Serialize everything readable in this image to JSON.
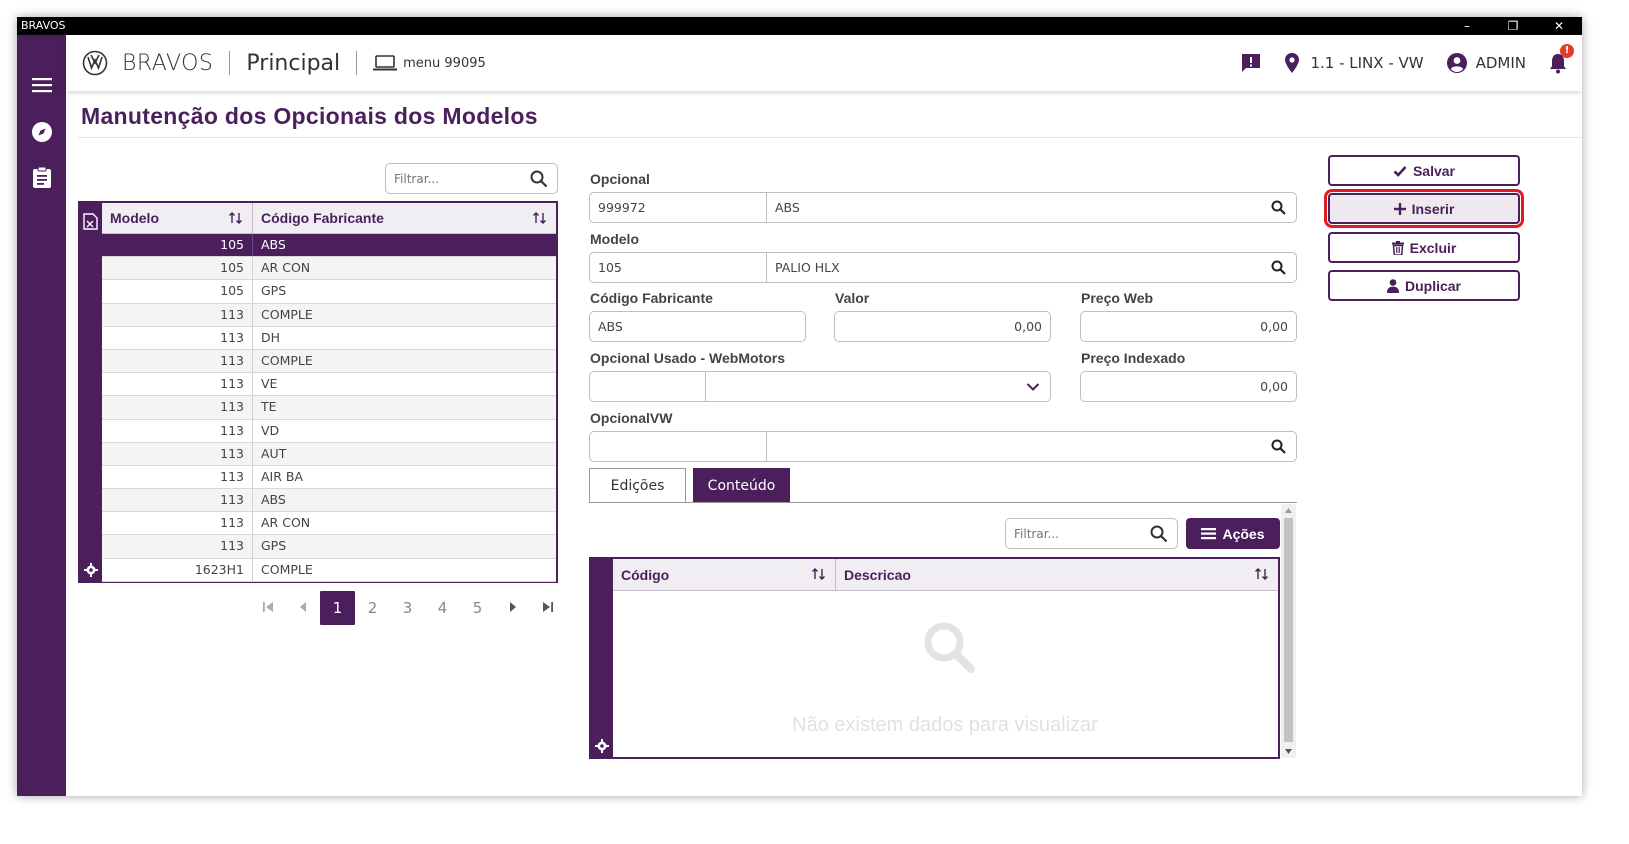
{
  "window": {
    "title": "BRAVOS",
    "minimize": "–",
    "restore": "❐",
    "close": "✕"
  },
  "header": {
    "brand": "BRAVOS",
    "section": "Principal",
    "menu": "menu 99095",
    "location": "1.1 - LINX - VW",
    "user": "ADMIN",
    "notification_badge": "!"
  },
  "page": {
    "title": "Manutenção dos Opcionais dos Modelos"
  },
  "left_grid": {
    "filter_placeholder": "Filtrar...",
    "columns": [
      "Modelo",
      "Código Fabricante"
    ],
    "rows": [
      {
        "modelo": "105",
        "codigo": "ABS",
        "selected": true
      },
      {
        "modelo": "105",
        "codigo": "AR CON"
      },
      {
        "modelo": "105",
        "codigo": "GPS"
      },
      {
        "modelo": "113",
        "codigo": "COMPLE"
      },
      {
        "modelo": "113",
        "codigo": "DH"
      },
      {
        "modelo": "113",
        "codigo": "COMPLE"
      },
      {
        "modelo": "113",
        "codigo": "VE"
      },
      {
        "modelo": "113",
        "codigo": "TE"
      },
      {
        "modelo": "113",
        "codigo": "VD"
      },
      {
        "modelo": "113",
        "codigo": "AUT"
      },
      {
        "modelo": "113",
        "codigo": "AIR BA"
      },
      {
        "modelo": "113",
        "codigo": "ABS"
      },
      {
        "modelo": "113",
        "codigo": "AR CON"
      },
      {
        "modelo": "113",
        "codigo": "GPS"
      },
      {
        "modelo": "1623H1",
        "codigo": "COMPLE"
      }
    ],
    "pages": [
      "1",
      "2",
      "3",
      "4",
      "5"
    ],
    "current_page": "1"
  },
  "form": {
    "opcional_label": "Opcional",
    "opcional_code": "999972",
    "opcional_desc": "ABS",
    "modelo_label": "Modelo",
    "modelo_code": "105",
    "modelo_desc": "PALIO HLX",
    "codigo_fabricante_label": "Código Fabricante",
    "codigo_fabricante": "ABS",
    "valor_label": "Valor",
    "valor": "0,00",
    "preco_web_label": "Preço Web",
    "preco_web": "0,00",
    "opcional_usado_label": "Opcional Usado - WebMotors",
    "preco_indexado_label": "Preço Indexado",
    "preco_indexado": "0,00",
    "opcional_vw_label": "OpcionalVW"
  },
  "tabs": [
    {
      "label": "Edições",
      "active": false
    },
    {
      "label": "Conteúdo",
      "active": true
    }
  ],
  "sub_grid": {
    "filter_placeholder": "Filtrar...",
    "acoes_label": "Ações",
    "columns": [
      "Código",
      "Descricao"
    ],
    "empty_message": "Não existem dados para visualizar"
  },
  "actions": {
    "salvar": "Salvar",
    "inserir": "Inserir",
    "excluir": "Excluir",
    "duplicar": "Duplicar"
  },
  "colors": {
    "primary": "#4a1f5c",
    "highlight": "#e11b22"
  }
}
